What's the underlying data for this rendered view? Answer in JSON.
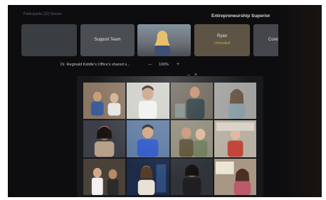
{
  "window": {
    "corner_label": "Participants (32) Stream",
    "session_title": "Entrepreneurship Superior"
  },
  "participant_strip": {
    "tiles": [
      {
        "label": ""
      },
      {
        "label": "Support Team"
      },
      {
        "label": ""
      },
      {
        "name": "Ryan",
        "status": "Unmuted"
      },
      {
        "label": "CoreSchedule"
      }
    ]
  },
  "share_bar": {
    "title": "Dr. Reginald Kiddle's Office's shared s...",
    "zoom_minus": "—",
    "zoom_value": "100%",
    "zoom_plus": "+"
  },
  "shared_screen": {
    "tiles": [
      "participant-1",
      "participant-2",
      "participant-3",
      "participant-4",
      "participant-5",
      "participant-6",
      "participant-7",
      "participant-8",
      "participant-9",
      "participant-10",
      "participant-11",
      "participant-12"
    ]
  },
  "colors": {
    "status_warning": "#d5a642",
    "background": "#0d0d0f"
  }
}
